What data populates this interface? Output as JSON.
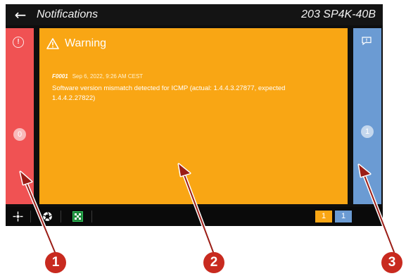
{
  "header": {
    "back_glyph": "←",
    "title": "Notifications",
    "device_name": "203 SP4K-40B"
  },
  "left_panel": {
    "icon": "error-icon",
    "icon_glyph": "!",
    "count": "0",
    "color": "#f05253"
  },
  "center_panel": {
    "color": "#f9a614",
    "severity": "Warning",
    "notification": {
      "code": "F0001",
      "datetime": "Sep 6, 2022, 9:26 AM CEST",
      "message": "Software version mismatch detected for ICMP (actual: 1.4.4.3.27877, expected 1.4.4.2.27822)"
    }
  },
  "right_panel": {
    "icon": "message-icon",
    "count": "1",
    "color": "#6b9bd3"
  },
  "statusbar": {
    "warning_count": "1",
    "info_count": "1",
    "warning_color": "#f9a614",
    "info_color": "#6b9bd3"
  },
  "callouts": [
    "1",
    "2",
    "3"
  ],
  "callout_color": "#c82a1f"
}
